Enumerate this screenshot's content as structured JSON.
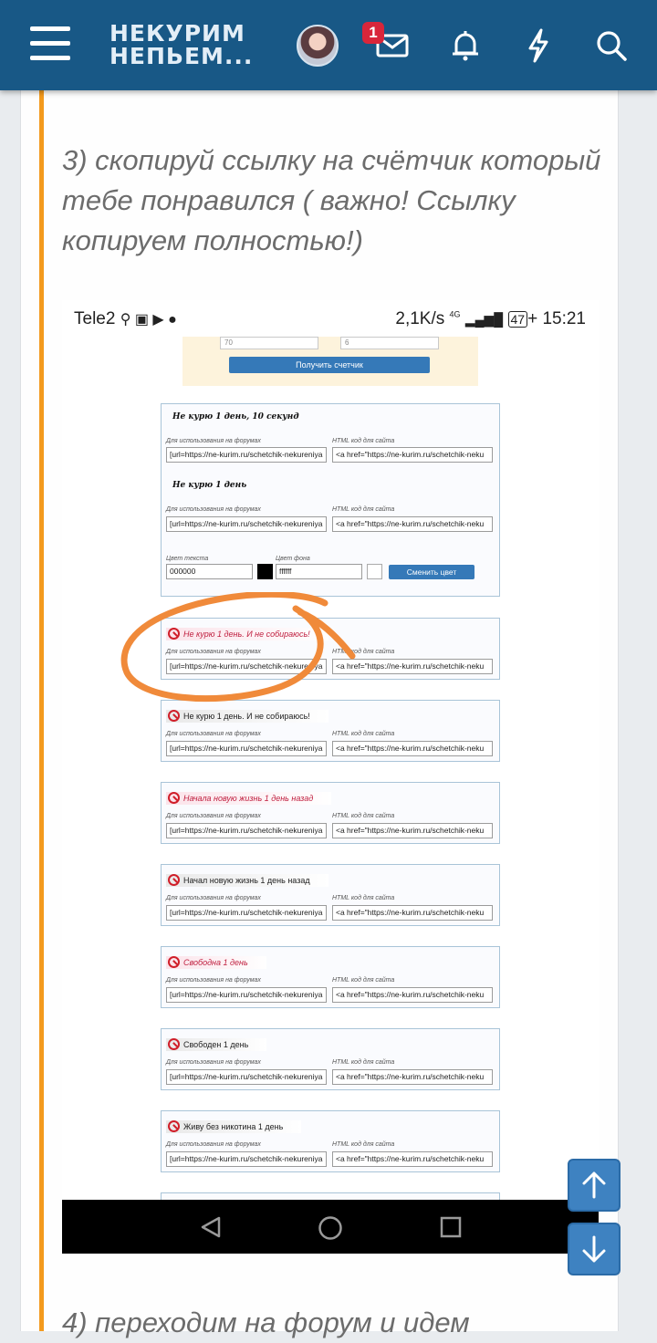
{
  "header": {
    "logo_line1": "НЕКУРИМ",
    "logo_line2": "НЕПЬЕМ...",
    "notification_count": "1",
    "colors": {
      "bar": "#185886",
      "accent": "#f39a1d"
    }
  },
  "post": {
    "step3_text": "3) скопируй ссылку на счётчик который тебе понравился ( важно! Ссылку копируем полностью!)",
    "step4_text": "4) переходим на форум и идем"
  },
  "screenshot": {
    "status": {
      "carrier": "Tele2",
      "speed": "2,1K/s",
      "network": "4G",
      "battery": "47",
      "time": "15:21"
    },
    "top_form": {
      "input1": "70",
      "input2": "6",
      "button": "Получить счетчик"
    },
    "color_section": {
      "text_color_label": "Цвет текста",
      "text_color_value": "000000",
      "bg_color_label": "Цвет фона",
      "bg_color_value": "ffffff",
      "button": "Сменить цвет"
    },
    "forum_label": "Для использования на форумах",
    "html_label": "HTML код для сайта",
    "forum_code": "[url=https://ne-kurim.ru/schetchik-nekureniya",
    "html_code": "<a href=\"https://ne-kurim.ru/schetchik-neku",
    "first_card_titles": [
      "Не курю 1 день, 10 секунд",
      "Не курю 1 день"
    ],
    "counters": [
      "Не курю 1 день. И не собираюсь!",
      "Не курю 1 день. И не собираюсь!",
      "Начала новую жизнь 1 день назад",
      "Начал новую жизнь 1 день назад",
      "Свободна 1 день",
      "Свободен 1 день",
      "Живу без никотина 1 день"
    ]
  }
}
